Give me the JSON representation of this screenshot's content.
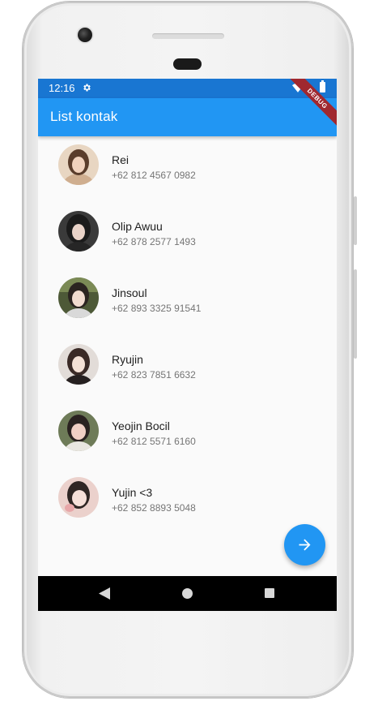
{
  "status_bar": {
    "time": "12:16"
  },
  "app_bar": {
    "title": "List kontak",
    "debug_banner": "DEBUG"
  },
  "contacts": [
    {
      "name": "Rei",
      "phone": "+62 812 4567 0982",
      "avatar_tone": "#c9a487"
    },
    {
      "name": "Olip Awuu",
      "phone": "+62 878 2577 1493",
      "avatar_tone": "#3b3b3b"
    },
    {
      "name": "Jinsoul",
      "phone": "+62 893 3325 91541",
      "avatar_tone": "#4f5a3a"
    },
    {
      "name": "Ryujin",
      "phone": "+62 823 7851 6632",
      "avatar_tone": "#d8d2cf"
    },
    {
      "name": "Yeojin Bocil",
      "phone": "+62 812 5571 6160",
      "avatar_tone": "#6b7a57"
    },
    {
      "name": "Yujin <3",
      "phone": "+62 852 8893 5048",
      "avatar_tone": "#e8c9c4"
    }
  ],
  "fab": {
    "icon": "arrow-forward-icon"
  },
  "nav_bar": {
    "icons": [
      "back-icon",
      "home-icon",
      "recents-icon"
    ]
  },
  "colors": {
    "primary": "#2196f3",
    "primary_dark": "#1976d2",
    "debug": "#a0282f"
  }
}
